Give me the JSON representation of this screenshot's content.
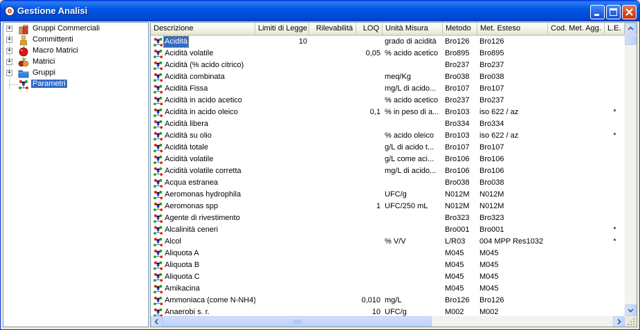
{
  "window": {
    "title": "Gestione Analisi"
  },
  "tree": {
    "items": [
      {
        "label": "Gruppi Commerciali",
        "icon": "commercial-groups-icon"
      },
      {
        "label": "Committenti",
        "icon": "customer-icon"
      },
      {
        "label": "Macro Matrici",
        "icon": "macro-matrix-icon"
      },
      {
        "label": "Matrici",
        "icon": "matrix-icon"
      },
      {
        "label": "Gruppi",
        "icon": "folder-icon"
      },
      {
        "label": "Parametri",
        "icon": "molecule-icon"
      }
    ]
  },
  "grid": {
    "columns": [
      {
        "label": "Descrizione"
      },
      {
        "label": "Limiti di Legge"
      },
      {
        "label": "Rilevabilità"
      },
      {
        "label": "LOQ"
      },
      {
        "label": "Unità Misura"
      },
      {
        "label": "Metodo"
      },
      {
        "label": "Met. Esteso"
      },
      {
        "label": "Cod. Met. Agg."
      },
      {
        "label": "L.E."
      }
    ],
    "rows": [
      {
        "desc": "Acidità",
        "lim": "10",
        "ril": "",
        "loq": "",
        "um": "grado di acidità",
        "met": "Bro126",
        "ext": "Bro126",
        "cod": "",
        "le": ""
      },
      {
        "desc": "Acidità  volatile",
        "lim": "",
        "ril": "",
        "loq": "0,05",
        "um": "% acido acetico",
        "met": "Bro895",
        "ext": "Bro895",
        "cod": "",
        "le": ""
      },
      {
        "desc": "Acidità (% acido citrico)",
        "lim": "",
        "ril": "",
        "loq": "",
        "um": "",
        "met": "Bro237",
        "ext": "Bro237",
        "cod": "",
        "le": ""
      },
      {
        "desc": "Acidità combinata",
        "lim": "",
        "ril": "",
        "loq": "",
        "um": "meq/Kg",
        "met": "Bro038",
        "ext": "Bro038",
        "cod": "",
        "le": ""
      },
      {
        "desc": "Acidità Fissa",
        "lim": "",
        "ril": "",
        "loq": "",
        "um": "mg/L di acido...",
        "met": "Bro107",
        "ext": "Bro107",
        "cod": "",
        "le": ""
      },
      {
        "desc": "Acidità in acido acetico",
        "lim": "",
        "ril": "",
        "loq": "",
        "um": "% acido acetico",
        "met": "Bro237",
        "ext": "Bro237",
        "cod": "",
        "le": ""
      },
      {
        "desc": "Acidità in acido oleico",
        "lim": "",
        "ril": "",
        "loq": "0,1",
        "um": "% in peso di a...",
        "met": "Bro103",
        "ext": "iso 622 / az",
        "cod": "",
        "le": "*"
      },
      {
        "desc": "Acidità libera",
        "lim": "",
        "ril": "",
        "loq": "",
        "um": "",
        "met": "Bro334",
        "ext": "Bro334",
        "cod": "",
        "le": ""
      },
      {
        "desc": "Acidità su olio",
        "lim": "",
        "ril": "",
        "loq": "",
        "um": "% acido oleico",
        "met": "Bro103",
        "ext": "iso 622 / az",
        "cod": "",
        "le": "*"
      },
      {
        "desc": "Acidità totale",
        "lim": "",
        "ril": "",
        "loq": "",
        "um": "g/L di acido t...",
        "met": "Bro107",
        "ext": "Bro107",
        "cod": "",
        "le": ""
      },
      {
        "desc": "Acidità volatile",
        "lim": "",
        "ril": "",
        "loq": "",
        "um": "g/L come aci...",
        "met": "Bro106",
        "ext": "Bro106",
        "cod": "",
        "le": ""
      },
      {
        "desc": "Acidità volatile corretta",
        "lim": "",
        "ril": "",
        "loq": "",
        "um": "mg/L di acido...",
        "met": "Bro106",
        "ext": "Bro106",
        "cod": "",
        "le": ""
      },
      {
        "desc": "Acqua estranea",
        "lim": "",
        "ril": "",
        "loq": "",
        "um": "",
        "met": "Bro038",
        "ext": "Bro038",
        "cod": "",
        "le": ""
      },
      {
        "desc": "Aeromonas hydrophila",
        "lim": "",
        "ril": "",
        "loq": "",
        "um": "UFC/g",
        "met": "N012M",
        "ext": "N012M",
        "cod": "",
        "le": ""
      },
      {
        "desc": "Aeromonas spp",
        "lim": "",
        "ril": "",
        "loq": "1",
        "um": "UFC/250 mL",
        "met": "N012M",
        "ext": "N012M",
        "cod": "",
        "le": ""
      },
      {
        "desc": "Agente di rivestimento",
        "lim": "",
        "ril": "",
        "loq": "",
        "um": "",
        "met": "Bro323",
        "ext": "Bro323",
        "cod": "",
        "le": ""
      },
      {
        "desc": "Alcalinità ceneri",
        "lim": "",
        "ril": "",
        "loq": "",
        "um": "",
        "met": "Bro001",
        "ext": "Bro001",
        "cod": "",
        "le": "*"
      },
      {
        "desc": "Alcol",
        "lim": "",
        "ril": "",
        "loq": "",
        "um": "%  V/V",
        "met": "L/R03",
        "ext": "004 MPP Res1032",
        "cod": "",
        "le": "*"
      },
      {
        "desc": "Aliquota A",
        "lim": "",
        "ril": "",
        "loq": "",
        "um": "",
        "met": "M045",
        "ext": "M045",
        "cod": "",
        "le": ""
      },
      {
        "desc": "Aliquota B",
        "lim": "",
        "ril": "",
        "loq": "",
        "um": "",
        "met": "M045",
        "ext": "M045",
        "cod": "",
        "le": ""
      },
      {
        "desc": "Aliquota C",
        "lim": "",
        "ril": "",
        "loq": "",
        "um": "",
        "met": "M045",
        "ext": "M045",
        "cod": "",
        "le": ""
      },
      {
        "desc": "Amikacina",
        "lim": "",
        "ril": "",
        "loq": "",
        "um": "",
        "met": "M045",
        "ext": "M045",
        "cod": "",
        "le": ""
      },
      {
        "desc": "Ammoniaca (come N-NH4)",
        "lim": "",
        "ril": "",
        "loq": "0,010",
        "um": "mg/L",
        "met": "Bro126",
        "ext": "Bro126",
        "cod": "",
        "le": ""
      },
      {
        "desc": "Anaerobi s. r.",
        "lim": "",
        "ril": "",
        "loq": "10",
        "um": "UFC/g",
        "met": "M002",
        "ext": "M002",
        "cod": "",
        "le": ""
      }
    ],
    "selected_index": 0
  }
}
